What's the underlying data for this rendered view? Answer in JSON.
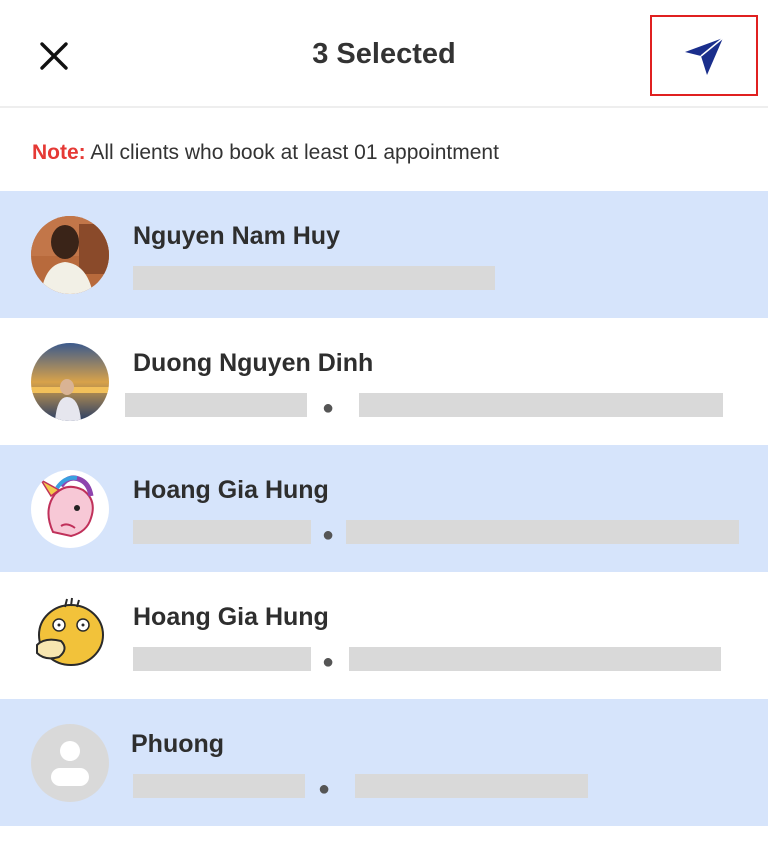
{
  "header": {
    "title": "3 Selected",
    "close_icon": "close-icon",
    "send_icon": "send-icon"
  },
  "note": {
    "label": "Note:",
    "text": "All clients who book at least 01 appointment"
  },
  "colors": {
    "selected_row": "#d6e4fb",
    "note_label": "#e53935",
    "send_icon": "#1a2e8c",
    "highlight_border": "#e02020"
  },
  "clients": [
    {
      "name": "Nguyen Nam Huy",
      "selected": true,
      "avatar": "photo-boy"
    },
    {
      "name": "Duong Nguyen Dinh",
      "selected": false,
      "avatar": "photo-sunset"
    },
    {
      "name": "Hoang Gia Hung",
      "selected": true,
      "avatar": "unicorn-sticker"
    },
    {
      "name": "Hoang Gia Hung",
      "selected": false,
      "avatar": "duck-sticker"
    },
    {
      "name": "Phuong",
      "selected": true,
      "avatar": "default-person"
    }
  ]
}
